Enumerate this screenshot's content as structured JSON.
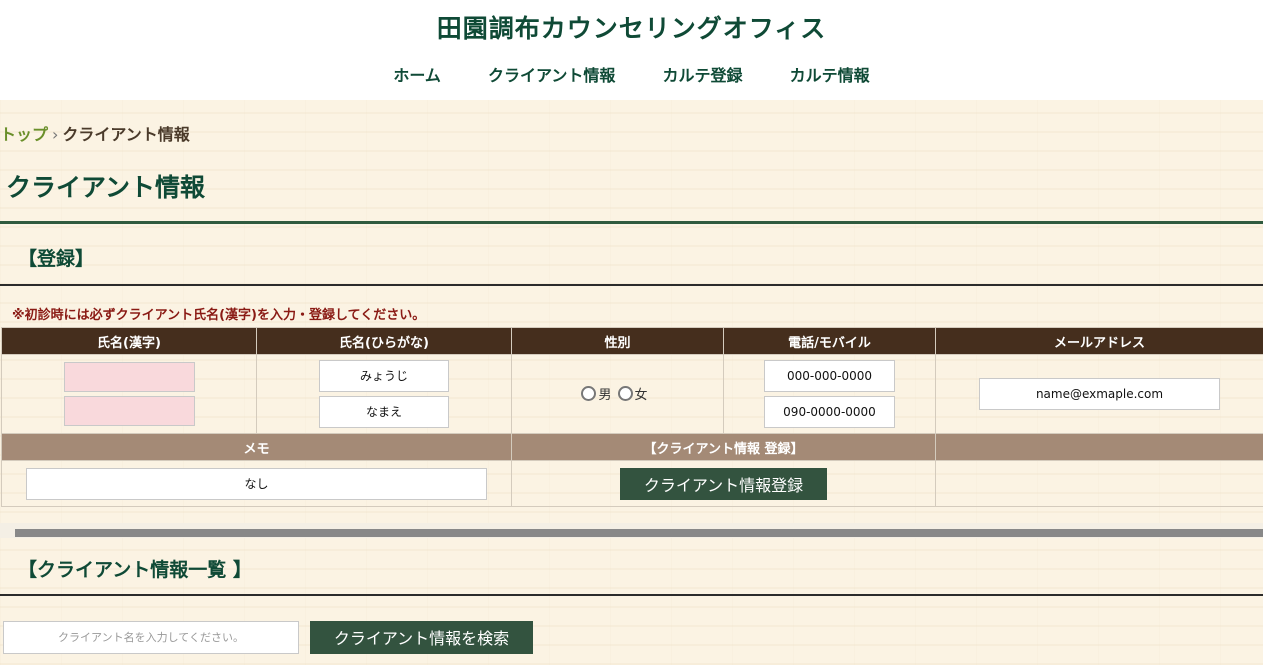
{
  "site": {
    "title": "田園調布カウンセリングオフィス"
  },
  "nav": [
    "ホーム",
    "クライアント情報",
    "カルテ登録",
    "カルテ情報"
  ],
  "breadcrumb": {
    "top": "トップ",
    "separator": "›",
    "current": "クライアント情報"
  },
  "page_title": "クライアント情報",
  "register": {
    "section_title": "【登録】",
    "notice": "※初診時には必ずクライアント氏名(漢字)を入力・登録してください。",
    "headers": [
      "氏名(漢字)",
      "氏名(ひらがな)",
      "性別",
      "電話/モバイル",
      "メールアドレス"
    ],
    "kanji_last": "",
    "kanji_first": "",
    "hiragana_last": "みょうじ",
    "hiragana_first": "なまえ",
    "gender_options": [
      "男",
      "女"
    ],
    "phone": "000-000-0000",
    "mobile": "090-0000-0000",
    "email": "name@exmaple.com",
    "memo_header": "メモ",
    "submit_header": "【クライアント情報 登録】",
    "memo_value": "なし",
    "submit_label": "クライアント情報登録"
  },
  "list": {
    "section_title": "【クライアント情報一覧 】",
    "search_placeholder": "クライアント名を入力してください。",
    "search_button": "クライアント情報を検索"
  },
  "colors": {
    "primary_green": "#0f4a36",
    "header_brown": "#452e1d",
    "subheader_tan": "#a48a76",
    "button_green": "#33533f",
    "notice_red": "#8a1a14",
    "kanji_input_pink": "#f9d9dc"
  }
}
